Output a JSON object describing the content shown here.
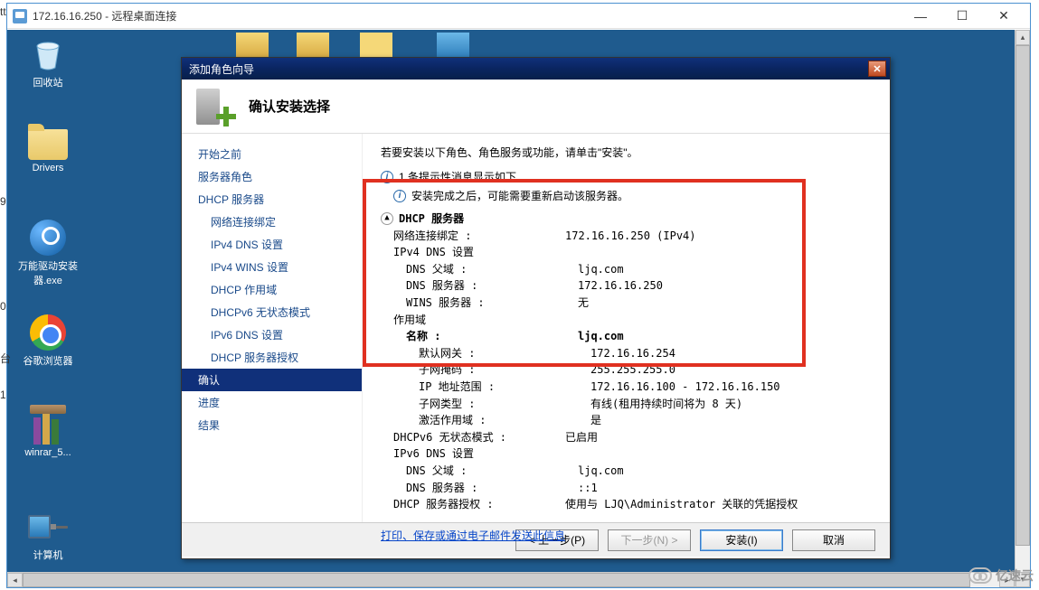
{
  "rdp": {
    "title": "172.16.16.250 - 远程桌面连接"
  },
  "desktop": {
    "recycle": "回收站",
    "drivers": "Drivers",
    "exe1": "万能驱动安装器.exe",
    "chrome": "谷歌浏览器",
    "winrar": "winrar_5...",
    "computer": "计算机"
  },
  "wizard": {
    "title": "添加角色向导",
    "header": "确认安装选择",
    "nav": {
      "before": "开始之前",
      "roles": "服务器角色",
      "dhcp": "DHCP 服务器",
      "netbind": "网络连接绑定",
      "ipv4dns": "IPv4 DNS 设置",
      "ipv4wins": "IPv4 WINS 设置",
      "scope": "DHCP 作用域",
      "v6stateless": "DHCPv6 无状态模式",
      "ipv6dns": "IPv6 DNS 设置",
      "auth": "DHCP 服务器授权",
      "confirm": "确认",
      "progress": "进度",
      "result": "结果"
    },
    "content": {
      "intro": "若要安装以下角色、角色服务或功能，请单击\"安装\"。",
      "info_count": "1 条提示性消息显示如下",
      "warn": "安装完成之后，可能需要重新启动该服务器。",
      "section": "DHCP 服务器",
      "rows": {
        "netbind_k": "网络连接绑定 :",
        "netbind_v": "172.16.16.250 (IPv4)",
        "v4dns_head": "IPv4 DNS 设置",
        "dns_parent_k": "DNS 父域 :",
        "dns_parent_v": "ljq.com",
        "dns_server_k": "DNS 服务器 :",
        "dns_server_v": "172.16.16.250",
        "wins_k": "WINS 服务器 :",
        "wins_v": "无",
        "scope_head": "作用域",
        "name_k": "名称 :",
        "name_v": "ljq.com",
        "gw_k": "默认网关 :",
        "gw_v": "172.16.16.254",
        "mask_k": "子网掩码 :",
        "mask_v": "255.255.255.0",
        "range_k": "IP 地址范围 :",
        "range_v": "172.16.16.100 - 172.16.16.150",
        "stype_k": "子网类型 :",
        "stype_v": "有线(租用持续时间将为 8 天)",
        "activate_k": "激活作用域 :",
        "activate_v": "是",
        "v6state_k": "DHCPv6 无状态模式 :",
        "v6state_v": "已启用",
        "v6dns_head": "IPv6 DNS 设置",
        "v6parent_k": "DNS 父域 :",
        "v6parent_v": "ljq.com",
        "v6server_k": "DNS 服务器 :",
        "v6server_v": "::1",
        "auth_k": "DHCP 服务器授权 :",
        "auth_v": "使用与 LJQ\\Administrator 关联的凭据授权"
      },
      "link": "打印、保存或通过电子邮件发送此信息"
    },
    "footer": {
      "prev": "< 上一步(P)",
      "next": "下一步(N) >",
      "install": "安装(I)",
      "cancel": "取消"
    }
  },
  "watermark": "亿速云",
  "edge": {
    "t1": "tt",
    "t2": "9",
    "t3": "0",
    "t4": "台",
    "t5": "1"
  }
}
